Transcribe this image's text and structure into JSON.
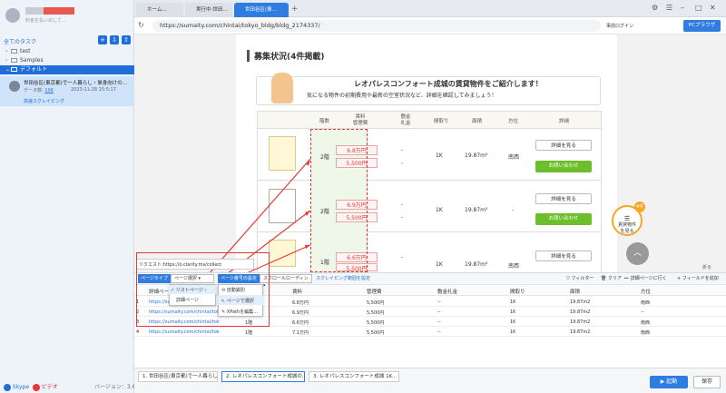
{
  "sidebar": {
    "subtitle": "料金を払い出して...",
    "all_tasks": "全てのタスク",
    "tree": [
      "test",
      "Samples",
      "デフォルト"
    ],
    "task": {
      "title": "世田谷区(東京都)で一人暮らし・単身向けの...",
      "pages_label": "データ数:",
      "pages_value": "106",
      "date": "2023-11-28 15:5:17",
      "cloud_link": "高速スクレイピング"
    },
    "bottom_skype": "Skype",
    "bottom_video": "ビデオ",
    "version": "バージョン：3.6.4"
  },
  "tabs": [
    "ホーム...",
    "実行中:世田...",
    "世田谷区(東..."
  ],
  "url": "https://sumaity.com/chintai/tokyo_bldg/bldg_2174337/",
  "login": "事前ログイン",
  "browser_btn": "PCブラウザ",
  "web": {
    "section_title": "募集状況(4件掲載)",
    "banner_title": "レオパレスコンフォート成城の賃貸物件をご紹介します！",
    "banner_sub": "気になる物件の初期費用や最新の空室状況など、詳細を確認してみましょう！",
    "headers": [
      "階数",
      "賃料\n管理費",
      "敷金\n礼金",
      "間取り",
      "面積",
      "方位",
      "詳細"
    ],
    "rows": [
      {
        "floor": "2階",
        "rent": "6.8万円",
        "fee": "5,500円",
        "deposit": "-",
        "key": "-",
        "layout": "1K",
        "area": "19.87m²",
        "dir": "南西"
      },
      {
        "floor": "2階",
        "rent": "6.9万円",
        "fee": "5,500円",
        "deposit": "-",
        "key": "-",
        "layout": "1K",
        "area": "19.87m²",
        "dir": "-"
      },
      {
        "floor": "1階",
        "rent": "6.6万円",
        "fee": "5,500円",
        "deposit": "-",
        "key": "-",
        "layout": "1K",
        "area": "19.87m²",
        "dir": "南西"
      }
    ],
    "detail_btn": "詳細を見る",
    "inquiry_btn": "お問い合わせ",
    "float_badge": "4件",
    "float_text": "賃貸物件\nを見る",
    "fold": "折る"
  },
  "request_bar": "リクエスト:https://o.clarity.ms/collect",
  "toolbar": {
    "page_type": "ページタイプ",
    "page_select": "ページ選択",
    "pagination": "ページ番号の設定",
    "scroll": "スクロールローディン",
    "scroll_range": "スクレイピング範囲を設定",
    "filter": "フィルター",
    "clear": "クリア",
    "goto_detail": "詳細ページに行く",
    "add_field": "フィールドを追加"
  },
  "dropdown": [
    "リストページ",
    "詳細ページ"
  ],
  "submenu": [
    "自動識別",
    "ページで選択",
    "XPathを編集..."
  ],
  "grid": {
    "headers": [
      "詳細ペー",
      "賃料",
      "管理費",
      "敷金礼金",
      "間取り",
      "面積",
      "方位"
    ],
    "rows": [
      {
        "n": "1",
        "url": "https://sumaity...",
        "floor": "",
        "rent": "6.8万円",
        "fee": "5,500円",
        "key": "--",
        "layout": "1K",
        "area": "19.87m2",
        "dir": "南西"
      },
      {
        "n": "2",
        "url": "https://sumaity.com/chintai/toky",
        "floor": "",
        "rent": "6.9万円",
        "fee": "5,500円",
        "key": "--",
        "layout": "1K",
        "area": "19.87m2",
        "dir": "--"
      },
      {
        "n": "3",
        "url": "https://sumaity.com/chintai/toky",
        "floor": "1階",
        "rent": "6.6万円",
        "fee": "5,500円",
        "key": "--",
        "layout": "1K",
        "area": "19.87m2",
        "dir": "南西"
      },
      {
        "n": "4",
        "url": "https://sumaity.com/chintai/toky",
        "floor": "1階",
        "rent": "7.1万円",
        "fee": "5,500円",
        "key": "--",
        "layout": "1K",
        "area": "19.87m2",
        "dir": "南西"
      }
    ]
  },
  "bottom_tabs": [
    "1. 世田谷区(東京都)で一人暮らし...",
    "2. レオパレスコンフォート成城の...",
    "3. レオパレスコンフォート成城 1K..."
  ],
  "start_btn": "起動",
  "save_btn": "保存"
}
